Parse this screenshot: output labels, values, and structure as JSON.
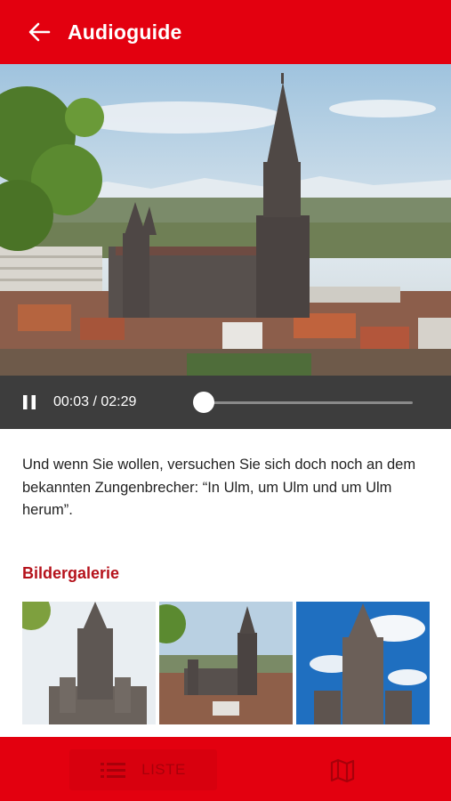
{
  "header": {
    "title": "Audioguide",
    "back_icon": "arrow-left-icon"
  },
  "hero": {
    "image": "ulm-minster-cityscape-photo"
  },
  "player": {
    "state_icon": "pause-icon",
    "time": "00:03 / 02:29",
    "progress": 0.02
  },
  "content": {
    "text": "Und wenn Sie wollen, versuchen Sie sich doch noch an dem bekannten Zungenbrecher: “In Ulm, um Ulm und um Ulm herum”."
  },
  "gallery": {
    "title": "Bildergalerie",
    "images": [
      "ulm-minster-tower-photo",
      "ulm-minster-cityscape-photo",
      "ulm-minster-blue-sky-photo"
    ]
  },
  "bottom_nav": {
    "list_label": "LISTE",
    "list_icon": "list-icon",
    "map_icon": "map-icon"
  },
  "colors": {
    "brand_red": "#e3000f",
    "player_bg": "#3d3d3d",
    "gallery_title": "#b5121b"
  }
}
